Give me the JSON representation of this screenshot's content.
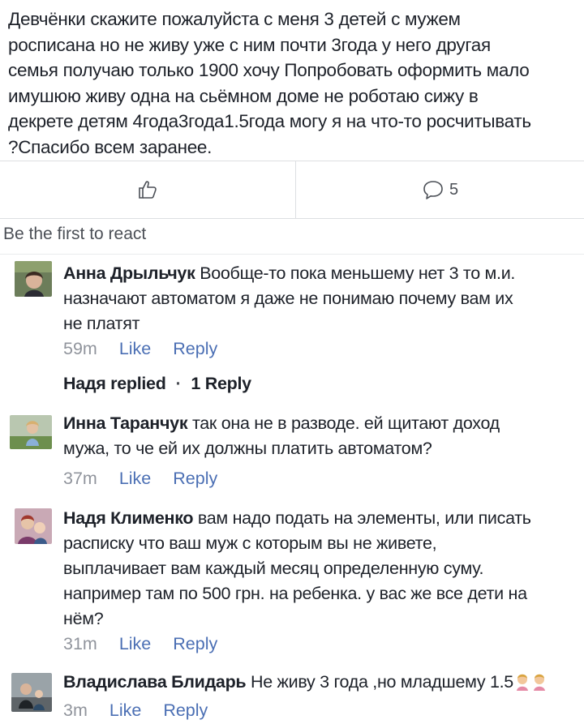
{
  "post": {
    "text_lines": [
      "Девчёнки скажите пожалуйста с меня  3 детей с мужем",
      "росписана но  не живу уже с ним почти 3года у него другая",
      "семья получаю только 1900 хочу  Попробовать оформить мало",
      "имушюю живу одна на сьёмном доме не роботаю  сижу в",
      "декрете детям  4года3года1.5года могу я на что-то росчитывать",
      "?Спасибо всем заранее."
    ]
  },
  "actions": {
    "like_icon": "thumbs-up-outline-icon",
    "comment_icon": "comment-bubble-icon",
    "comment_count": "5"
  },
  "reactions": {
    "label": "Be the first to react"
  },
  "comments": [
    {
      "author": "Анна Дрыльчук",
      "lines": [
        " Вообще-то пока меньшему нет 3 то м.и.",
        "назначают автоматом я даже не понимаю почему вам их",
        "не платят"
      ],
      "time": "59m",
      "like": "Like",
      "reply": "Reply"
    },
    {
      "author": "Инна Таранчук",
      "lines": [
        " так она не в разводе.  ей щитают доход",
        "мужа, то че ей их должны платить автоматом?"
      ],
      "time": "37m",
      "like": "Like",
      "reply": "Reply"
    },
    {
      "author": "Надя Клименко",
      "lines": [
        " вам надо подать на элементы, или писать",
        "расписку что ваш муж с которым вы не живете,",
        "выплачивает вам каждый месяц определенную суму.",
        "например там по 500 грн. на ребенка. у вас же все дети на",
        "нём?"
      ],
      "time": "31m",
      "like": "Like",
      "reply": "Reply"
    },
    {
      "author": "Владислава Блидарь",
      "lines": [
        " Не живу 3 года ,но младшему 1.5"
      ],
      "emoji": "woman-gesturing-emoji",
      "time": "3m",
      "like": "Like",
      "reply": "Reply"
    }
  ],
  "replies_summary": {
    "name": "Надя replied",
    "separator": "·",
    "count": "1 Reply"
  }
}
